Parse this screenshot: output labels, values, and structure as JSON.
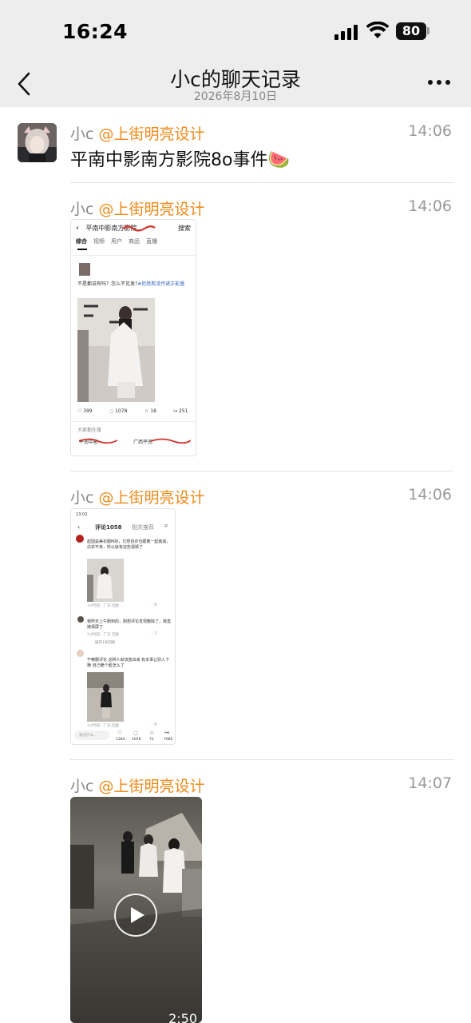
{
  "status_bar": {
    "time": "16:24",
    "battery": "80"
  },
  "header": {
    "title": "小c的聊天记录",
    "date": "2026年8月10日"
  },
  "messages": [
    {
      "sender": "小c",
      "org": "@上街明亮设计",
      "time": "14:06",
      "text": "平南中影南方影院8o事件🍉"
    },
    {
      "sender": "小c",
      "org": "@上街明亮设计",
      "time": "14:06"
    },
    {
      "sender": "小c",
      "org": "@上街明亮设计",
      "time": "14:06"
    },
    {
      "sender": "小c",
      "org": "@上街明亮设计",
      "time": "14:07"
    }
  ],
  "shot1": {
    "search_text": "平南中影南方影院...",
    "search_btn": "搜索",
    "tabs": [
      "综合",
      "视频",
      "用户",
      "商品",
      "直播"
    ],
    "post_text": "不是都说有吗？怎么不见发?",
    "post_tag": "#拒绝欺凌传递正能量",
    "likes": "399",
    "comments": "1078",
    "stars": "18",
    "shares": "251",
    "trending_label": "大家都在搜",
    "trend1": "平南中影",
    "trend2": "广西平南"
  },
  "shot2": {
    "status_time": "13:02",
    "tab1": "评论1058",
    "tab2": "相关推荐",
    "c1_text": "起因是美衣服M的，它想自衣也跟着一起装逼，白衣不肯，所以就有这些视频了",
    "c1_meta": "3小时前 · 广东   回复",
    "c1_likes": "6",
    "c2_text": "我昨天上午刷到的，刚想评论发现删除了，我直接保屏了",
    "c2_meta": "3小时前 · 广东   回复",
    "c2_likes": "1",
    "c2_more": "展开1条回复",
    "c3_text": "干嘛删评论 这种人就该放出来 有本事让别人下跪 自己跪个脸怎么了",
    "c3_meta": "3小时前 · 广东   回复",
    "c3_likes": "6",
    "input_placeholder": "说点什么...",
    "likes": "1284",
    "comments": "1058",
    "stars": "71",
    "shares": "7085"
  },
  "video": {
    "duration": "2:50"
  }
}
